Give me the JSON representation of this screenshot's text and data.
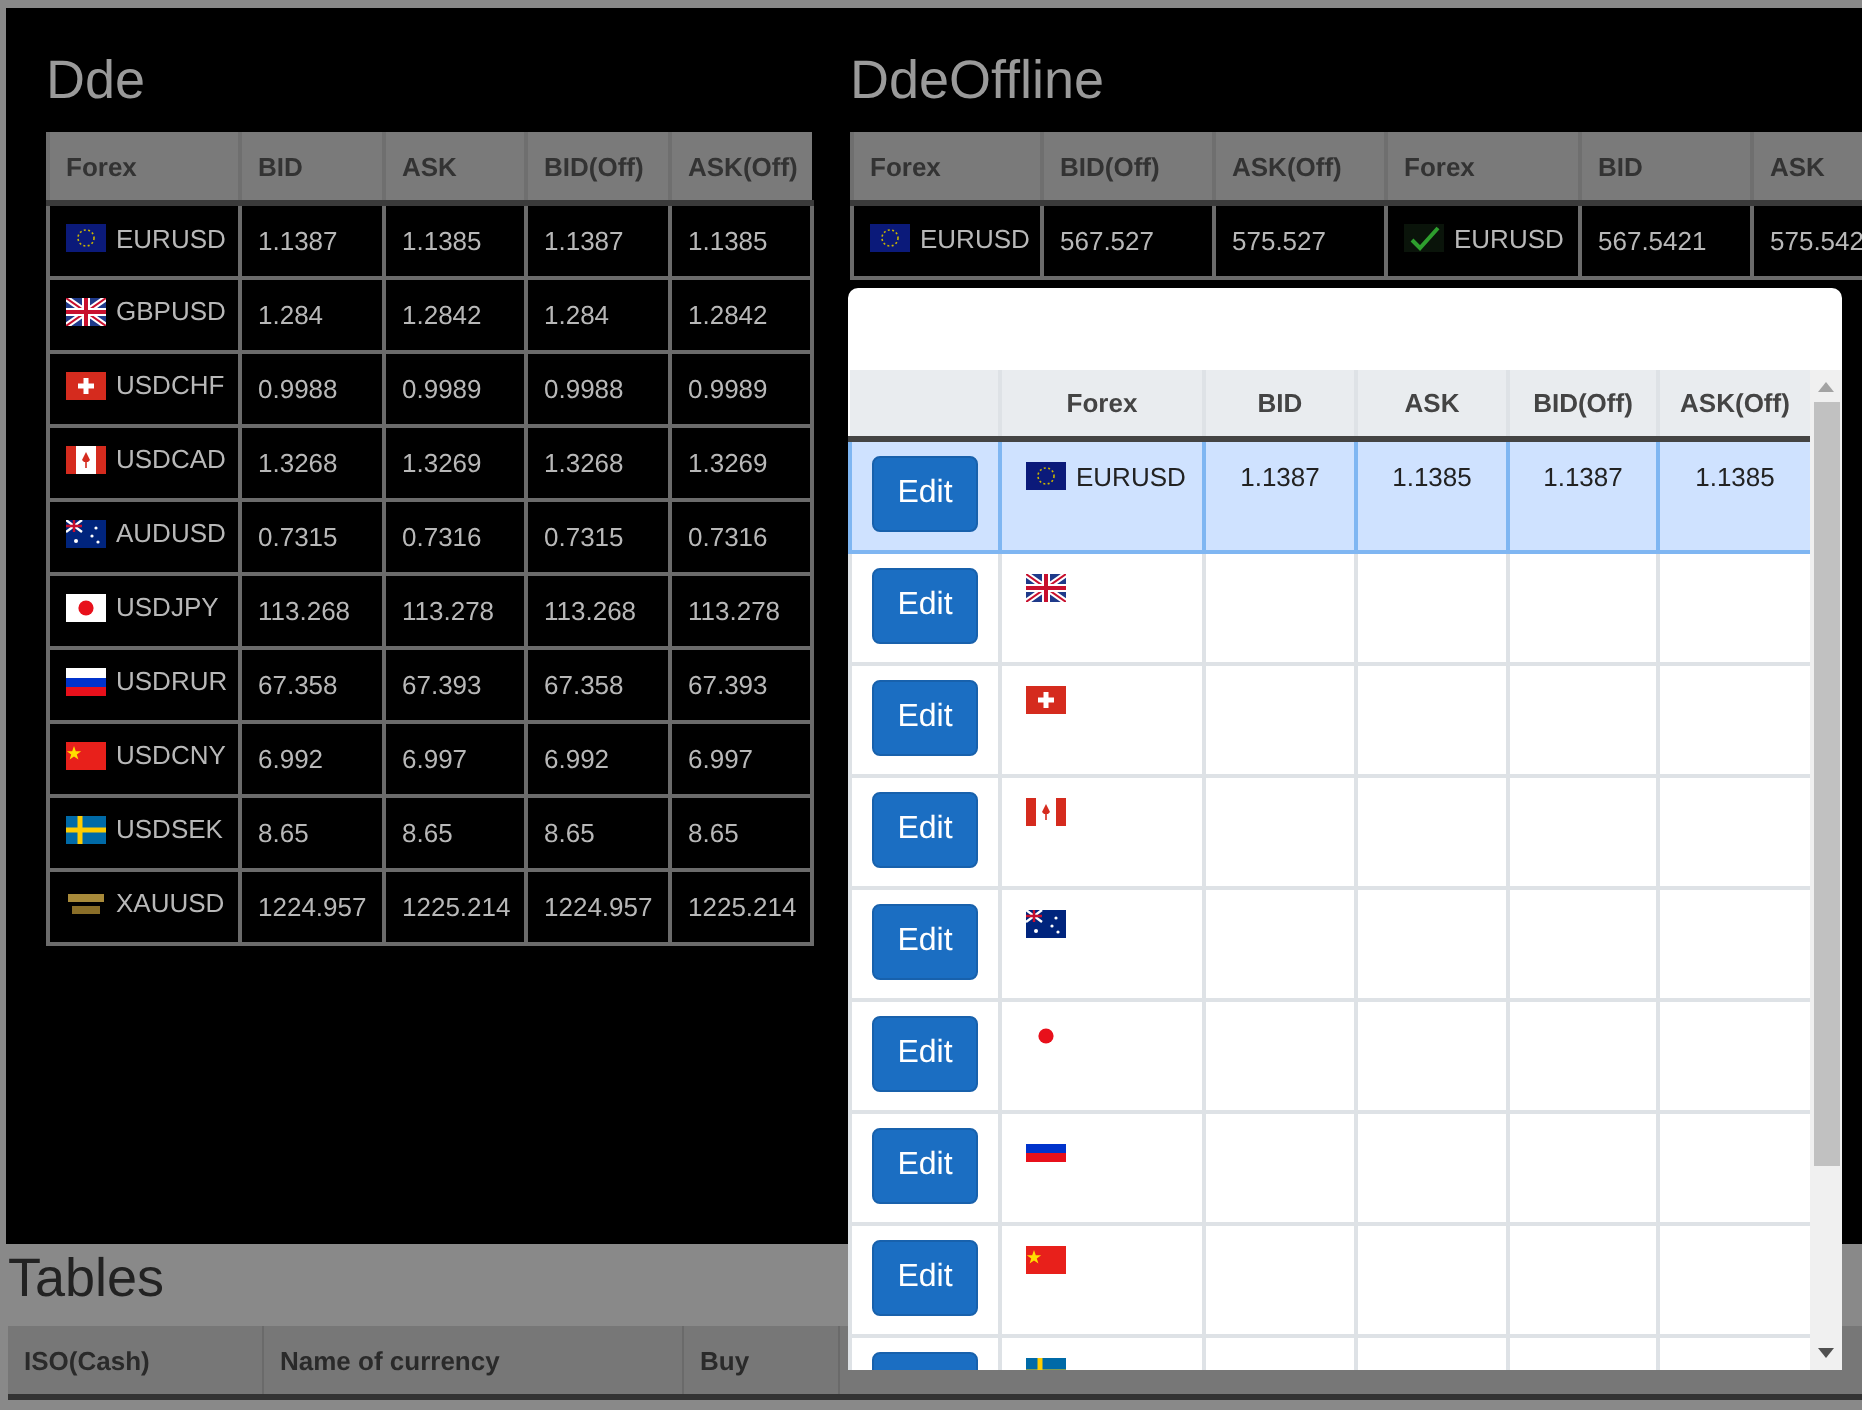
{
  "dde": {
    "title": "Dde",
    "columns": [
      "Forex",
      "BID",
      "ASK",
      "BID(Off)",
      "ASK(Off)"
    ],
    "rows": [
      {
        "kind": "eu",
        "cells": [
          "EURUSD",
          "1.1387",
          "1.1385",
          "1.1387",
          "1.1385"
        ]
      },
      {
        "kind": "gb",
        "cells": [
          "GBPUSD",
          "1.284",
          "1.2842",
          "1.284",
          "1.2842"
        ]
      },
      {
        "kind": "ch",
        "cells": [
          "USDCHF",
          "0.9988",
          "0.9989",
          "0.9988",
          "0.9989"
        ]
      },
      {
        "kind": "ca",
        "cells": [
          "USDCAD",
          "1.3268",
          "1.3269",
          "1.3268",
          "1.3269"
        ]
      },
      {
        "kind": "au",
        "cells": [
          "AUDUSD",
          "0.7315",
          "0.7316",
          "0.7315",
          "0.7316"
        ]
      },
      {
        "kind": "jp",
        "cells": [
          "USDJPY",
          "113.268",
          "113.278",
          "113.268",
          "113.278"
        ]
      },
      {
        "kind": "ru",
        "cells": [
          "USDRUR",
          "67.358",
          "67.393",
          "67.358",
          "67.393"
        ]
      },
      {
        "kind": "cn",
        "cells": [
          "USDCNY",
          "6.992",
          "6.997",
          "6.992",
          "6.997"
        ]
      },
      {
        "kind": "se",
        "cells": [
          "USDSEK",
          "8.65",
          "8.65",
          "8.65",
          "8.65"
        ]
      },
      {
        "kind": "gold",
        "cells": [
          "XAUUSD",
          "1224.957",
          "1225.214",
          "1224.957",
          "1225.214"
        ]
      }
    ]
  },
  "dde_offline": {
    "title": "DdeOffline",
    "columns": [
      "Forex",
      "BID(Off)",
      "ASK(Off)",
      "Forex",
      "BID",
      "ASK"
    ],
    "rows": [
      {
        "cells": [
          {
            "kind": "eu",
            "text": "EURUSD"
          },
          {
            "text": "567.527"
          },
          {
            "text": "575.527"
          },
          {
            "kind": "check",
            "text": "EURUSD"
          },
          {
            "text": "567.5421"
          },
          {
            "text": "575.542"
          }
        ]
      }
    ]
  },
  "tables": {
    "title": "Tables",
    "columns": [
      "ISO(Cash)",
      "Name of currency",
      "Buy"
    ]
  },
  "dialog": {
    "columns": [
      "Forex",
      "BID",
      "ASK",
      "BID(Off)",
      "ASK(Off)"
    ],
    "rows": [
      {
        "button": "Edit",
        "selected": true,
        "kind": "eu",
        "cells": [
          "EURUSD",
          "1.1387",
          "1.1385",
          "1.1387",
          "1.1385"
        ]
      },
      {
        "button": "Edit",
        "selected": false,
        "kind": "gb",
        "cells": []
      },
      {
        "button": "Edit",
        "selected": false,
        "kind": "ch",
        "cells": []
      },
      {
        "button": "Edit",
        "selected": false,
        "kind": "ca",
        "cells": []
      },
      {
        "button": "Edit",
        "selected": false,
        "kind": "au",
        "cells": []
      },
      {
        "button": "Edit",
        "selected": false,
        "kind": "jp",
        "cells": []
      },
      {
        "button": "Edit",
        "selected": false,
        "kind": "ru",
        "cells": []
      },
      {
        "button": "Edit",
        "selected": false,
        "kind": "cn",
        "cells": []
      },
      {
        "selected": false,
        "kind": "se",
        "cells": []
      }
    ]
  }
}
